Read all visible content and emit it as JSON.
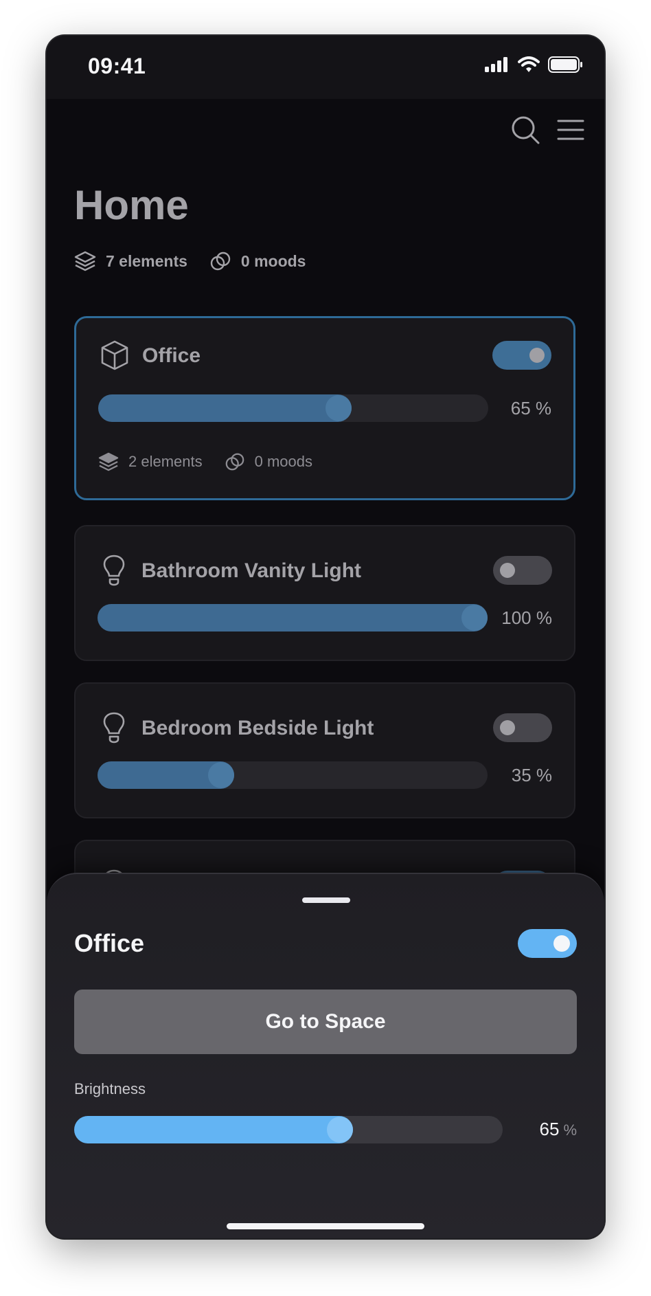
{
  "status_bar": {
    "time": "09:41",
    "icons": [
      "cellular-signal-icon",
      "wifi-icon",
      "battery-icon"
    ]
  },
  "header": {
    "icons": [
      "search-icon",
      "menu-icon"
    ]
  },
  "home": {
    "title": "Home",
    "elements_count": "7 elements",
    "moods_count": "0 moods"
  },
  "cards": [
    {
      "name": "Office",
      "icon": "cube-icon",
      "on": true,
      "brightness": 65,
      "value_label": "65 %",
      "elements_count": "2 elements",
      "moods_count": "0 moods",
      "selected": true
    },
    {
      "name": "Bathroom Vanity Light",
      "icon": "lightbulb-icon",
      "on": false,
      "brightness": 100,
      "value_label": "100 %"
    },
    {
      "name": "Bedroom Bedside Light",
      "icon": "lightbulb-icon",
      "on": false,
      "brightness": 35,
      "value_label": "35 %"
    },
    {
      "icon": "lightbulb-icon",
      "on": true
    }
  ],
  "sheet": {
    "title": "Office",
    "on": true,
    "go_button_label": "Go to Space",
    "brightness_label": "Brightness",
    "brightness": 65,
    "brightness_value": "65",
    "brightness_unit": "%"
  },
  "colors": {
    "accent": "#63b4f3",
    "card_fill": "#3e6a92",
    "selected_border": "#2e6a97",
    "background": "#0c0b0f"
  }
}
